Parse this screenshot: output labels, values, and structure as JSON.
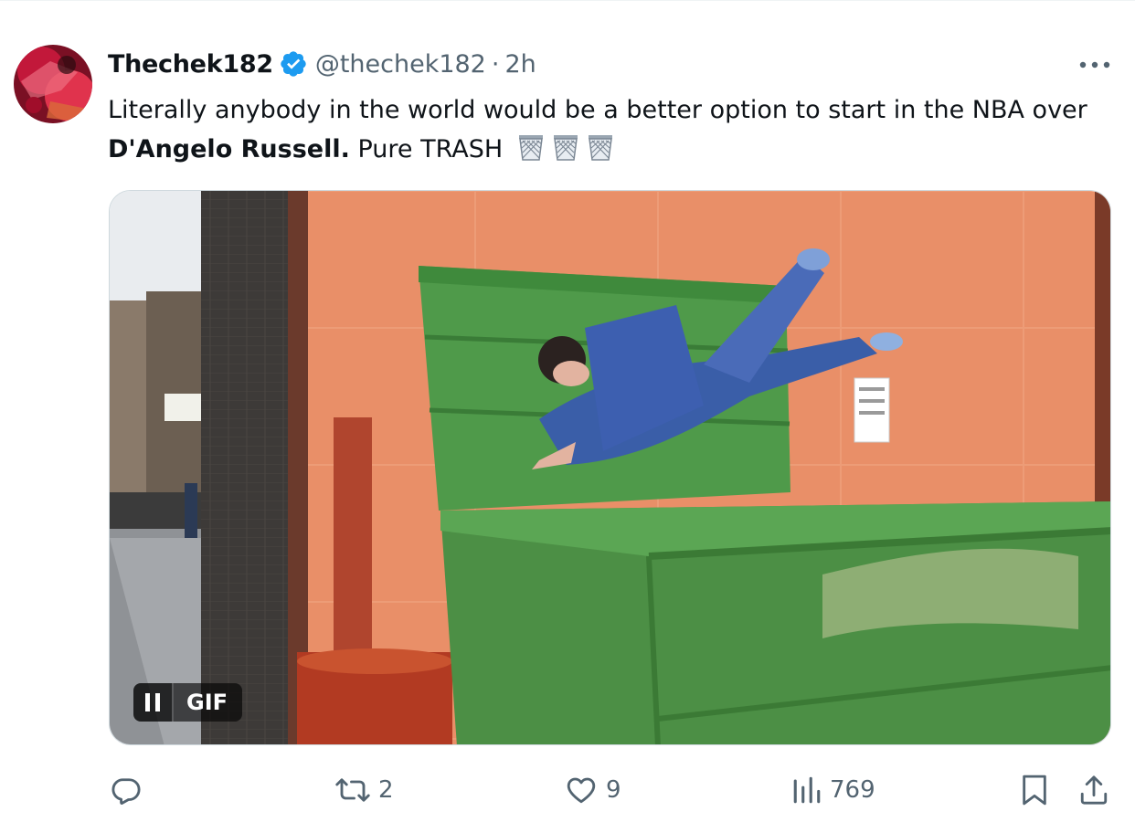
{
  "tweet": {
    "author": {
      "display_name": "Thechek182",
      "handle": "@thechek182",
      "verified": true,
      "avatar_icon": "avatar-image"
    },
    "separator": "·",
    "time": "2h",
    "text": {
      "part1": "Literally anybody in the world would be a better option to start in the NBA over ",
      "bold": "D'Angelo Russell.",
      "part2": " Pure TRASH",
      "emoji": [
        "wastebasket",
        "wastebasket",
        "wastebasket"
      ]
    },
    "media": {
      "type": "gif",
      "badge": "GIF",
      "pause_icon": "pause-icon"
    },
    "actions": {
      "reply": {
        "icon": "reply-icon",
        "count": ""
      },
      "retweet": {
        "icon": "retweet-icon",
        "count": "2"
      },
      "like": {
        "icon": "heart-icon",
        "count": "9"
      },
      "views": {
        "icon": "views-icon",
        "count": "769"
      },
      "bookmark": {
        "icon": "bookmark-icon"
      },
      "share": {
        "icon": "share-icon"
      }
    },
    "colors": {
      "text": "#0f1419",
      "secondary": "#536471",
      "verified": "#1d9bf0"
    }
  }
}
